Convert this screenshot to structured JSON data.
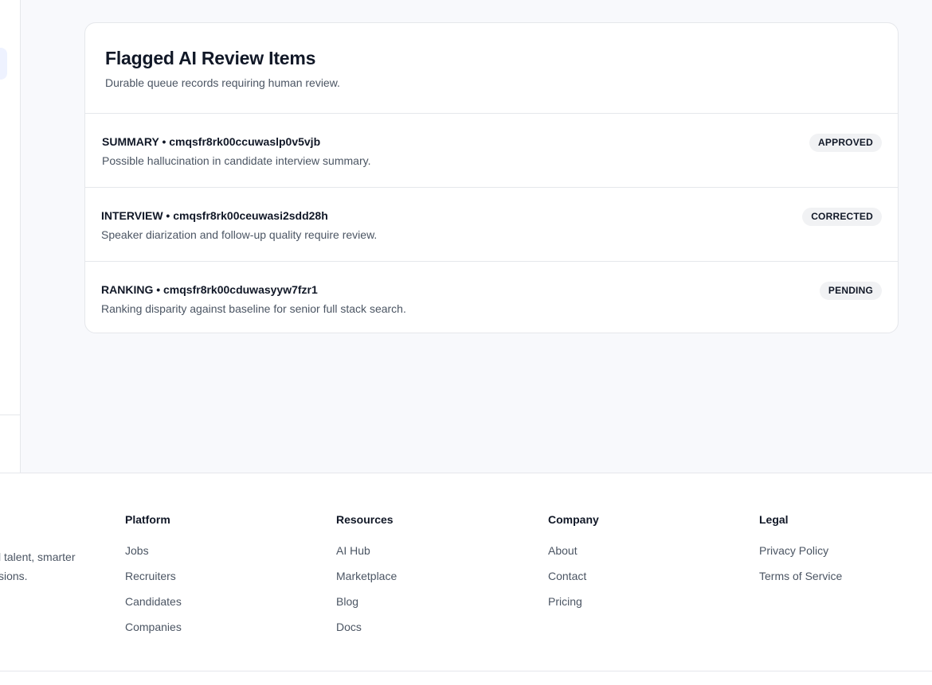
{
  "card": {
    "title": "Flagged AI Review Items",
    "subtitle": "Durable queue records requiring human review.",
    "items": [
      {
        "title": "SUMMARY • cmqsfr8rk00ccuwaslp0v5vjb",
        "description": "Possible hallucination in candidate interview summary.",
        "status": "APPROVED"
      },
      {
        "title": "INTERVIEW • cmqsfr8rk00ceuwasi2sdd28h",
        "description": "Speaker diarization and follow-up quality require review.",
        "status": "CORRECTED"
      },
      {
        "title": "RANKING • cmqsfr8rk00cduwasyyw7fzr1",
        "description": "Ranking disparity against baseline for senior full stack search.",
        "status": "PENDING"
      }
    ]
  },
  "footer": {
    "tagline": "l talent, smarter sions.",
    "tagline_line1": "l talent, smarter",
    "tagline_line2": "sions.",
    "columns": [
      {
        "heading": "Platform",
        "links": [
          "Jobs",
          "Recruiters",
          "Candidates",
          "Companies"
        ]
      },
      {
        "heading": "Resources",
        "links": [
          "AI Hub",
          "Marketplace",
          "Blog",
          "Docs"
        ]
      },
      {
        "heading": "Company",
        "links": [
          "About",
          "Contact",
          "Pricing"
        ]
      },
      {
        "heading": "Legal",
        "links": [
          "Privacy Policy",
          "Terms of Service"
        ]
      }
    ]
  },
  "colors": {
    "background": "#f8f9fc",
    "card_border": "#e5e7eb",
    "badge_bg": "#f1f2f4",
    "text_primary": "#111827",
    "text_secondary": "#4b5563"
  }
}
